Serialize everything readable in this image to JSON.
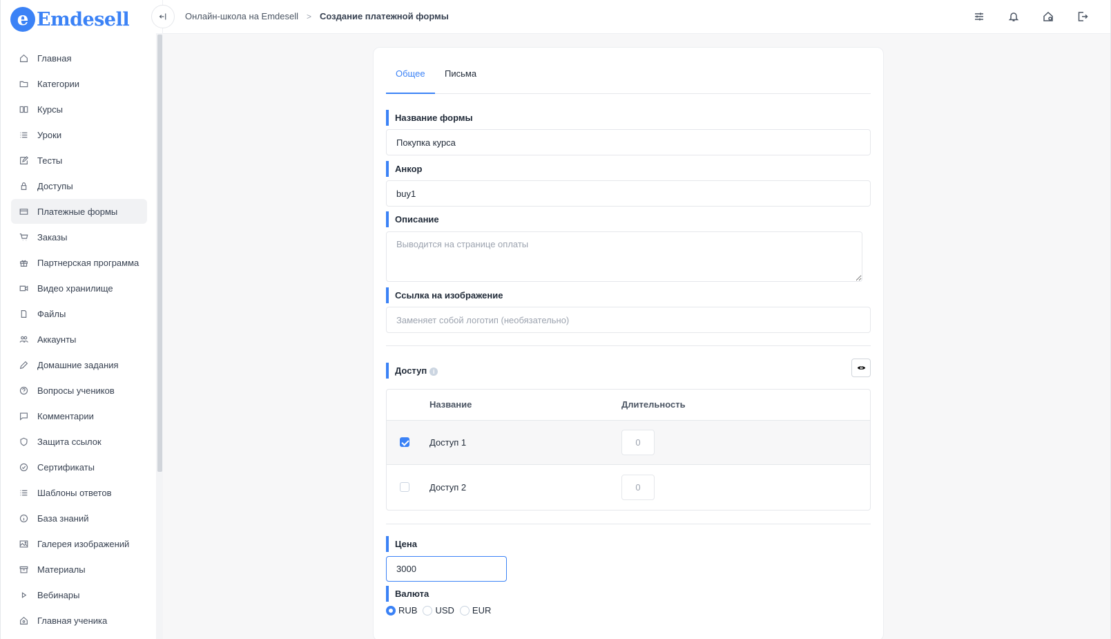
{
  "app": {
    "logo_letter": "e",
    "logo_text": "Emdesell"
  },
  "sidebar": {
    "items": [
      {
        "label": "Главная",
        "icon": "home-icon"
      },
      {
        "label": "Категории",
        "icon": "folder-icon"
      },
      {
        "label": "Курсы",
        "icon": "book-icon"
      },
      {
        "label": "Уроки",
        "icon": "list-icon"
      },
      {
        "label": "Тесты",
        "icon": "edit-icon"
      },
      {
        "label": "Доступы",
        "icon": "lock-icon"
      },
      {
        "label": "Платежные формы",
        "icon": "credit-card-icon",
        "active": true
      },
      {
        "label": "Заказы",
        "icon": "cart-icon"
      },
      {
        "label": "Партнерская программа",
        "icon": "gift-icon"
      },
      {
        "label": "Видео хранилище",
        "icon": "video-icon"
      },
      {
        "label": "Файлы",
        "icon": "file-icon"
      },
      {
        "label": "Аккаунты",
        "icon": "users-icon"
      },
      {
        "label": "Домашние задания",
        "icon": "pencil-icon"
      },
      {
        "label": "Вопросы учеников",
        "icon": "question-icon"
      },
      {
        "label": "Комментарии",
        "icon": "comment-icon"
      },
      {
        "label": "Защита ссылок",
        "icon": "shield-icon"
      },
      {
        "label": "Сертификаты",
        "icon": "certificate-icon"
      },
      {
        "label": "Шаблоны ответов",
        "icon": "list-icon"
      },
      {
        "label": "База знаний",
        "icon": "info-icon"
      },
      {
        "label": "Галерея изображений",
        "icon": "image-icon"
      },
      {
        "label": "Материалы",
        "icon": "archive-icon"
      },
      {
        "label": "Вебинары",
        "icon": "play-icon"
      },
      {
        "label": "Главная ученика",
        "icon": "home-user-icon"
      }
    ]
  },
  "topbar": {
    "breadcrumb_link": "Онлайн-школа на Emdesell",
    "breadcrumb_sep": ">",
    "breadcrumb_current": "Создание платежной формы",
    "icons": [
      "sliders-icon",
      "bell-icon",
      "home-settings-icon",
      "logout-icon"
    ]
  },
  "form": {
    "tabs": [
      "Общее",
      "Письма"
    ],
    "name_label": "Название формы",
    "name_value": "Покупка курса",
    "anchor_label": "Анкор",
    "anchor_value": "buy1",
    "description_label": "Описание",
    "description_placeholder": "Выводится на странице оплаты",
    "image_label": "Ссылка на изображение",
    "image_placeholder": "Заменяет собой логотип (необязательно)",
    "access_label": "Доступ",
    "access_table": {
      "headers": [
        "Название",
        "Длительность"
      ],
      "rows": [
        {
          "name": "Доступ 1",
          "duration": "0",
          "checked": true
        },
        {
          "name": "Доступ 2",
          "duration": "0",
          "checked": false
        }
      ]
    },
    "price_label": "Цена",
    "price_value": "3000",
    "currency_label": "Валюта",
    "currencies": [
      {
        "label": "RUB",
        "selected": true
      },
      {
        "label": "USD",
        "selected": false
      },
      {
        "label": "EUR",
        "selected": false
      }
    ]
  },
  "colors": {
    "accent": "#3b82f6",
    "text": "#1f2937",
    "border": "#e5e7eb",
    "bg": "#f7f7f8"
  }
}
